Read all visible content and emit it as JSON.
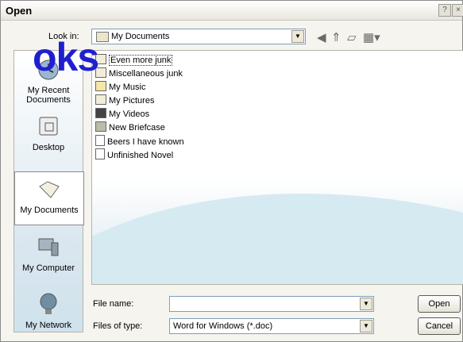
{
  "dialog": {
    "title": "Open",
    "help_glyph": "?",
    "close_glyph": "×"
  },
  "lookin": {
    "label": "Look in:",
    "value": "My Documents"
  },
  "toolbar": {
    "back_icon": "back-icon",
    "up_icon": "up-folder-icon",
    "new_folder_icon": "new-folder-icon",
    "views_icon": "views-menu-icon"
  },
  "places": [
    {
      "label": "My Recent Documents",
      "icon": "recent-documents-icon"
    },
    {
      "label": "Desktop",
      "icon": "desktop-icon"
    },
    {
      "label": "My Documents",
      "icon": "my-documents-icon"
    },
    {
      "label": "My Computer",
      "icon": "my-computer-icon"
    },
    {
      "label": "My Network",
      "icon": "my-network-icon"
    }
  ],
  "files": [
    {
      "name": "Even more junk",
      "icon": "folder-icon"
    },
    {
      "name": "Miscellaneous junk",
      "icon": "folder-icon"
    },
    {
      "name": "My Music",
      "icon": "music-folder-icon"
    },
    {
      "name": "My Pictures",
      "icon": "pictures-folder-icon"
    },
    {
      "name": "My Videos",
      "icon": "videos-folder-icon"
    },
    {
      "name": "New Briefcase",
      "icon": "briefcase-icon"
    },
    {
      "name": "Beers I have known",
      "icon": "word-document-icon"
    },
    {
      "name": "Unfinished Novel",
      "icon": "word-document-icon"
    }
  ],
  "filename": {
    "label": "File name:",
    "value": ""
  },
  "filetype": {
    "label": "Files of type:",
    "value": "Word for Windows (*.doc)"
  },
  "buttons": {
    "open": "Open",
    "cancel": "Cancel"
  },
  "watermark": "oks",
  "colors": {
    "watermark": "#1f1fd0",
    "field_border": "#7f9db9",
    "bg": "#f5f4ee"
  }
}
